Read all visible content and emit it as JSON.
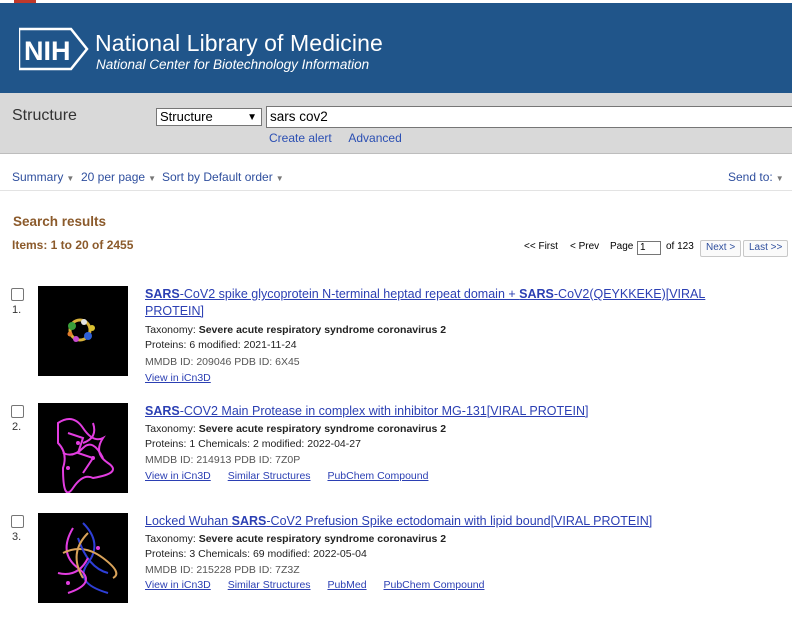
{
  "header": {
    "logo_text": "NIH",
    "title": "National Library of Medicine",
    "subtitle": "National Center for Biotechnology Information",
    "bg_color": "#20558a"
  },
  "search": {
    "db_label": "Structure",
    "db_selected": "Structure",
    "query": "sars cov2",
    "links": [
      "Create alert",
      "Advanced"
    ]
  },
  "toolbar": {
    "summary": "Summary",
    "per_page": "20 per page",
    "sort": "Sort by Default order",
    "send_to": "Send to:"
  },
  "results_heading": "Search results",
  "items_count": "Items: 1 to 20 of 2455",
  "pager": {
    "first": "<< First",
    "prev": "< Prev",
    "page_label": "Page",
    "page_value": "1",
    "of_pages": "of 123",
    "next": "Next >",
    "last": "Last >>"
  },
  "results": [
    {
      "num": "1.",
      "title_bold1": "SARS",
      "title_part1": "-CoV2 spike glycoprotein N-terminal heptad repeat domain + ",
      "title_bold2": "SARS",
      "title_part2": "-CoV2(QEYKKEKE)[VIRAL PROTEIN]",
      "taxonomy_label": "Taxonomy:",
      "taxonomy": "Severe acute respiratory syndrome coronavirus 2",
      "counts": "Proteins: 6  modified: 2021-11-24",
      "ids": "MMDB ID: 209046   PDB ID: 6X45",
      "links": [
        "View in iCn3D"
      ]
    },
    {
      "num": "2.",
      "title_bold1": "SARS",
      "title_part1": "-COV2 Main Protease in complex with inhibitor MG-131[VIRAL PROTEIN]",
      "taxonomy_label": "Taxonomy:",
      "taxonomy": "Severe acute respiratory syndrome coronavirus 2",
      "counts": "Proteins: 1  Chemicals: 2  modified: 2022-04-27",
      "ids": "MMDB ID: 214913   PDB ID: 7Z0P",
      "links": [
        "View in iCn3D",
        "Similar Structures",
        "PubChem Compound"
      ]
    },
    {
      "num": "3.",
      "title_part0": "Locked Wuhan ",
      "title_bold1": "SARS",
      "title_part1": "-CoV2 Prefusion Spike ectodomain with lipid bound[VIRAL PROTEIN]",
      "taxonomy_label": "Taxonomy:",
      "taxonomy": "Severe acute respiratory syndrome coronavirus 2",
      "counts": "Proteins: 3  Chemicals: 69  modified: 2022-05-04",
      "ids": "MMDB ID: 215228   PDB ID: 7Z3Z",
      "links": [
        "View in iCn3D",
        "Similar Structures",
        "PubMed",
        "PubChem Compound"
      ]
    }
  ]
}
